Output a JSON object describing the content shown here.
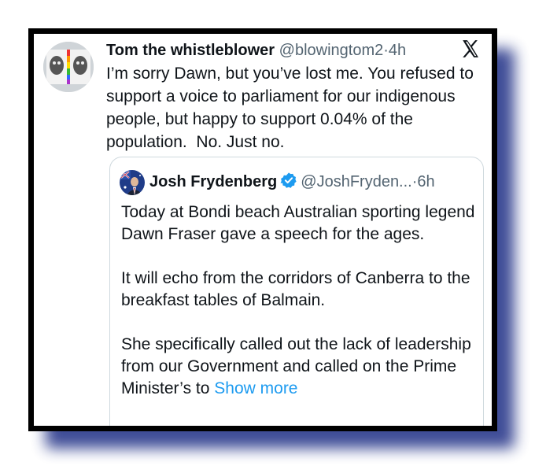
{
  "tweet": {
    "author_name": "Tom the whistleblower",
    "handle": "@blowingtom2",
    "separator": "·",
    "time": "4h",
    "icons": {
      "avatar": "mirrored-faces-avatar",
      "platform": "x-logo-icon"
    },
    "text": "I’m sorry Dawn, but you’ve lost me. You refused to support a voice to parliament for our indigenous people, but happy to support 0.04% of the population.  No. Just no."
  },
  "quoted_tweet": {
    "author_name": "Josh Frydenberg",
    "handle": "@JoshFryden...",
    "separator": "·",
    "time": "6h",
    "verified": true,
    "icons": {
      "avatar": "flag-portrait-avatar",
      "verified": "verified-badge-icon"
    },
    "paragraphs": [
      "Today at Bondi beach Australian sporting legend Dawn Fraser gave a speech for the ages.",
      "It will echo from the corridors of Canberra to the breakfast tables of Balmain.",
      "She specifically called out the lack of leadership from our Government and called on the Prime Minister’s to"
    ],
    "show_more_label": "Show more"
  },
  "colors": {
    "text": "#0f1419",
    "muted": "#536471",
    "link": "#1d9bf0",
    "verified": "#1d9bf0",
    "frame": "#000000",
    "shadow": "#2b3a8c"
  }
}
